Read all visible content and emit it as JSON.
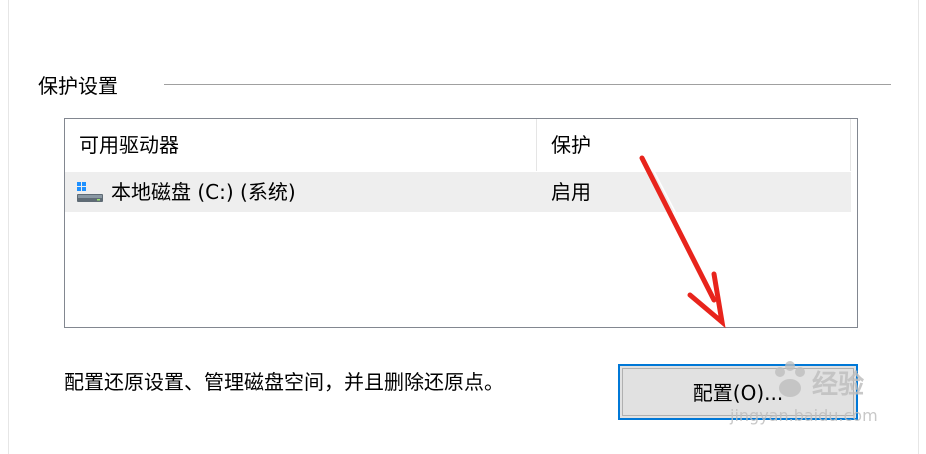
{
  "group": {
    "title": "保护设置"
  },
  "listview": {
    "columns": [
      "可用驱动器",
      "保护"
    ],
    "rows": [
      {
        "icon": "drive-icon",
        "drive": "本地磁盘 (C:) (系统)",
        "protection": "启用"
      }
    ]
  },
  "description": "配置还原设置、管理磁盘空间，并且删除还原点。",
  "config_button": {
    "label": "配置(O)..."
  },
  "watermark": {
    "brand": "经验",
    "url": "jingyan.baidu.com"
  },
  "colors": {
    "focus_border": "#0078d7",
    "arrow": "#e8241c",
    "row_highlight": "#eeeeee"
  }
}
